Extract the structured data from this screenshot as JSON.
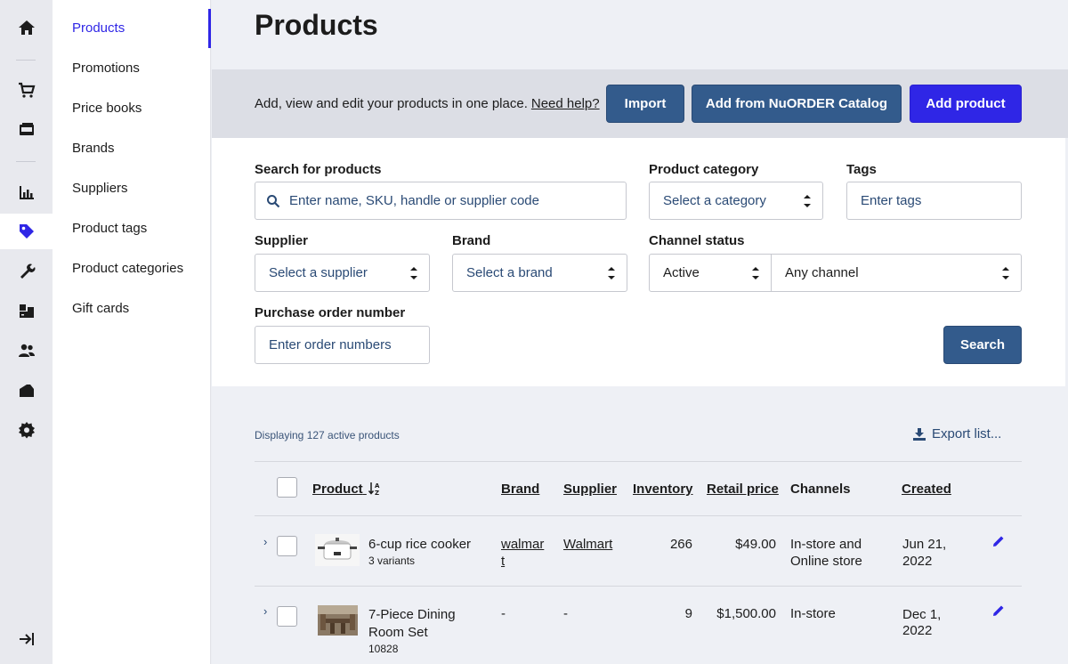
{
  "rail": {
    "items": [
      {
        "icon": "home-icon"
      },
      {
        "icon": "cart-icon"
      },
      {
        "icon": "register-icon"
      },
      {
        "icon": "reports-icon"
      },
      {
        "icon": "tag-icon",
        "active": true
      },
      {
        "icon": "wrench-icon"
      },
      {
        "icon": "boxes-icon"
      },
      {
        "icon": "customers-icon"
      },
      {
        "icon": "folder-icon"
      },
      {
        "icon": "gear-icon"
      },
      {
        "icon": "collapse-icon"
      }
    ]
  },
  "subnav": {
    "items": [
      "Products",
      "Promotions",
      "Price books",
      "Brands",
      "Suppliers",
      "Product tags",
      "Product categories",
      "Gift cards"
    ],
    "active": "Products"
  },
  "page": {
    "title": "Products",
    "banner_text": "Add, view and edit your products in one place.",
    "help_link": "Need help?",
    "import_label": "Import",
    "catalog_label": "Add from NuORDER Catalog",
    "add_label": "Add product"
  },
  "filters": {
    "search_label": "Search for products",
    "search_placeholder": "Enter name, SKU, handle or supplier code",
    "category_label": "Product category",
    "category_value": "Select a category",
    "tags_label": "Tags",
    "tags_placeholder": "Enter tags",
    "supplier_label": "Supplier",
    "supplier_value": "Select a supplier",
    "brand_label": "Brand",
    "brand_value": "Select a brand",
    "channel_label": "Channel status",
    "channel_status_value": "Active",
    "channel_value": "Any channel",
    "po_label": "Purchase order number",
    "po_placeholder": "Enter order numbers",
    "search_button": "Search"
  },
  "results": {
    "info": "Displaying 127 active products",
    "export_label": "Export list..."
  },
  "table": {
    "headers": {
      "product": "Product",
      "brand": "Brand",
      "supplier": "Supplier",
      "inventory": "Inventory",
      "retail_price": "Retail price",
      "channels": "Channels",
      "created": "Created"
    },
    "rows": [
      {
        "name": "6-cup rice cooker",
        "sub": "3 variants",
        "brand_l1": "walmar",
        "brand_l2": "t",
        "supplier": "Walmart",
        "inventory": "266",
        "price": "$49.00",
        "channels_l1": "In-store and",
        "channels_l2": "Online store",
        "created_l1": "Jun 21,",
        "created_l2": "2022"
      },
      {
        "name_l1": "7-Piece Dining",
        "name_l2": "Room Set",
        "sub": "10828",
        "brand": "-",
        "supplier": "-",
        "inventory": "9",
        "price": "$1,500.00",
        "channels": "In-store",
        "created_l1": "Dec 1,",
        "created_l2": "2022"
      }
    ]
  }
}
